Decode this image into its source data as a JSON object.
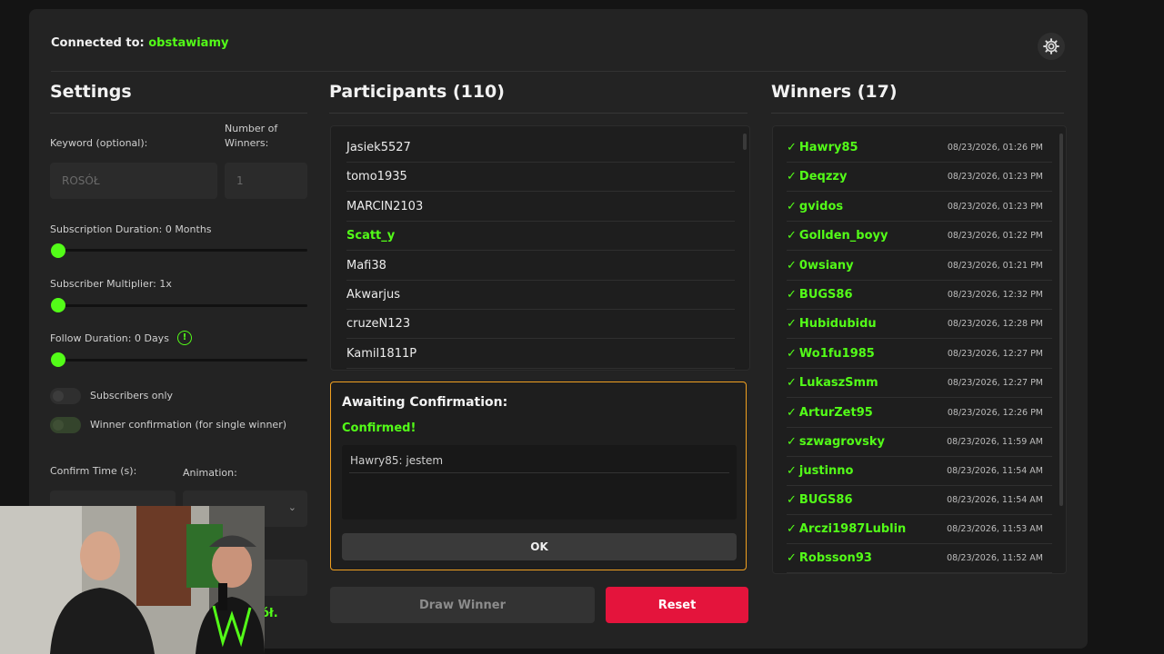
{
  "header": {
    "connected_label": "Connected to:",
    "channel": "obstawiamy"
  },
  "settings": {
    "title": "Settings",
    "keyword_label": "Keyword (optional):",
    "keyword_placeholder": "ROSÓŁ",
    "winners_label_1": "Number of",
    "winners_label_2": "Winners:",
    "winners_placeholder": "1",
    "sub_duration_label": "Subscription Duration: 0 Months",
    "sub_multiplier_label": "Subscriber Multiplier: 1x",
    "follow_duration_label": "Follow Duration:  0  Days",
    "info_glyph": "!",
    "subscribers_only_label": "Subscribers only",
    "winner_confirmation_label": "Winner confirmation (for single winner)",
    "confirm_time_label": "Confirm Time (s):",
    "animation_label": "Animation:",
    "obscured_text": "ół."
  },
  "participants": {
    "title": "Participants (110)",
    "items": [
      "Jasiek5527",
      "tomo1935",
      "MARCIN2103",
      "Scatt_y",
      "Mafi38",
      "Akwarjus",
      "cruzeN123",
      "Kamil1811P"
    ],
    "highlighted_index": 3
  },
  "confirmation": {
    "title": "Awaiting Confirmation:",
    "status": "Confirmed!",
    "message": "Hawry85: jestem",
    "ok_label": "OK"
  },
  "actions": {
    "draw_label": "Draw Winner",
    "reset_label": "Reset"
  },
  "winners": {
    "title": "Winners (17)",
    "check": "✓",
    "items": [
      {
        "name": "Hawry85",
        "time": "08/23/2026, 01:26 PM"
      },
      {
        "name": "Deqzzy",
        "time": "08/23/2026, 01:23 PM"
      },
      {
        "name": "gvidos",
        "time": "08/23/2026, 01:23 PM"
      },
      {
        "name": "Gollden_boyy",
        "time": "08/23/2026, 01:22 PM"
      },
      {
        "name": "0wsiany",
        "time": "08/23/2026, 01:21 PM"
      },
      {
        "name": "BUGS86",
        "time": "08/23/2026, 12:32 PM"
      },
      {
        "name": "Hubidubidu",
        "time": "08/23/2026, 12:28 PM"
      },
      {
        "name": "Wo1fu1985",
        "time": "08/23/2026, 12:27 PM"
      },
      {
        "name": "LukaszSmm",
        "time": "08/23/2026, 12:27 PM"
      },
      {
        "name": "ArturZet95",
        "time": "08/23/2026, 12:26 PM"
      },
      {
        "name": "szwagrovsky",
        "time": "08/23/2026, 11:59 AM"
      },
      {
        "name": "justinno",
        "time": "08/23/2026, 11:54 AM"
      },
      {
        "name": "BUGS86",
        "time": "08/23/2026, 11:54 AM"
      },
      {
        "name": "Arczi1987Lublin",
        "time": "08/23/2026, 11:53 AM"
      },
      {
        "name": "Robsson93",
        "time": "08/23/2026, 11:52 AM"
      }
    ]
  },
  "colors": {
    "accent": "#53fc18",
    "reset": "#e4143c",
    "confirm_border": "#f0a020"
  }
}
